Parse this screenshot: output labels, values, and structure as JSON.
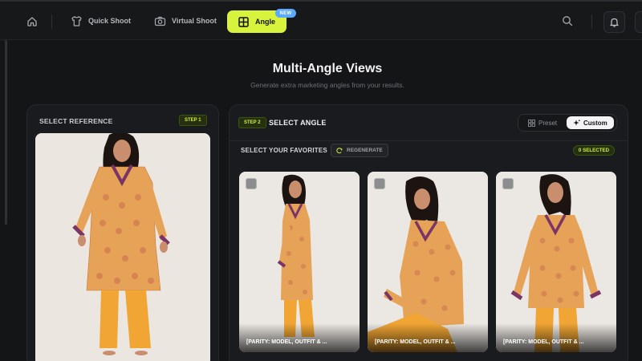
{
  "nav": {
    "home_icon": "home-icon",
    "items": [
      {
        "label": "Quick Shoot",
        "icon": "shirt-icon"
      },
      {
        "label": "Virtual Shoot",
        "icon": "camera-icon"
      }
    ],
    "active": {
      "label": "Angle",
      "icon": "grid-icon",
      "badge": "NEW"
    },
    "search_icon": "search-icon",
    "bell_icon": "bell-icon"
  },
  "page": {
    "title": "Multi-Angle Views",
    "subtitle": "Generate extra marketing angles from your results."
  },
  "reference_panel": {
    "label": "SELECT REFERENCE",
    "step": "STEP 1"
  },
  "angle_panel": {
    "step": "STEP 2",
    "label": "SELECT ANGLE",
    "mode_options": [
      "Preset",
      "Custom"
    ],
    "mode_selected": "Custom",
    "favorites_label": "SELECT YOUR FAVORITES",
    "regenerate_label": "REGENERATE",
    "selected_count_label": "0 SELECTED",
    "results": [
      {
        "caption": "[PARITY: MODEL, OUTFIT & ...",
        "selected": false
      },
      {
        "caption": "[PARITY: MODEL, OUTFIT & ...",
        "selected": false
      },
      {
        "caption": "[PARITY: MODEL, OUTFIT & ...",
        "selected": false
      }
    ]
  },
  "colors": {
    "accent": "#d8f33c",
    "badge_blue": "#5aa9ff",
    "background": "#141517",
    "panel": "#1a1b1e",
    "kurta": "#e6a257",
    "trim": "#7a3566",
    "trousers": "#f0a534"
  }
}
